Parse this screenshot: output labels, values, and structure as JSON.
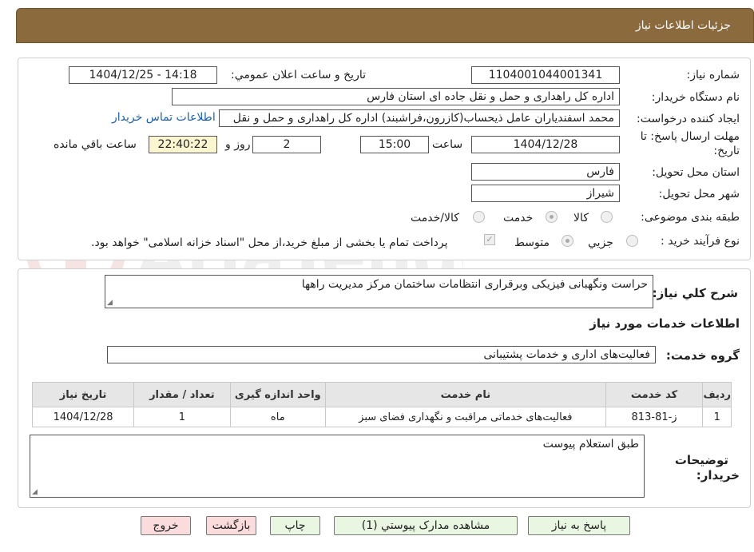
{
  "header": {
    "title": "جزئيات اطلاعات نياز"
  },
  "watermark": {
    "text": "AriaTender.neT"
  },
  "form": {
    "need_number_label": "شماره نياز:",
    "need_number": "1104001044001341",
    "announce_label": "تاريخ و ساعت اعلان عمومي:",
    "announce_value": "1404/12/25 - 14:18",
    "buyer_org_label": "نام دستگاه خريدار:",
    "buyer_org": "اداره کل راهداری و حمل و نقل جاده ای استان فارس",
    "creator_label": "ايجاد کننده درخواست:",
    "creator": "محمد اسفندیاران عامل ذیحساب(کازرون،فراشبند) اداره کل راهداری و حمل و نقل",
    "contact_link": "اطلاعات تماس خريدار",
    "deadline_label_1": "مهلت ارسال پاسخ: تا",
    "deadline_label_2": "تاريخ:",
    "deadline_date": "1404/12/28",
    "time_label": "ساعت",
    "deadline_time": "15:00",
    "days": "2",
    "days_label": "روز و",
    "remaining": "22:40:22",
    "remaining_label": "ساعت باقي مانده",
    "province_label": "استان محل تحويل:",
    "province": "فارس",
    "city_label": "شهر محل تحويل:",
    "city": "شيراز",
    "category_label": "طبقه بندی موضوعی:",
    "category_options": [
      "کالا",
      "خدمت",
      "کالا/خدمت"
    ],
    "category_selected": "خدمت",
    "process_label": "نوع فرآيند خريد :",
    "process_options": [
      "جزيي",
      "متوسط"
    ],
    "process_selected": "متوسط",
    "payment_note": "پرداخت تمام یا بخشی از مبلغ خرید،از محل \"اسناد خزانه اسلامی\" خواهد بود."
  },
  "description": {
    "label": "شرح کلي نياز:",
    "value": "حراست ونگهبانی فیزیکی وبرقراری انتظامات ساختمان مرکز مدیریت راهها"
  },
  "services": {
    "section_title": "اطلاعات خدمات مورد نياز",
    "group_label": "گروه خدمت:",
    "group_value": "فعالیت‌های اداری و خدمات پشتیبانی",
    "columns": [
      "رديف",
      "کد خدمت",
      "نام خدمت",
      "واحد اندازه گيری",
      "تعداد / مقدار",
      "تاريخ نياز"
    ],
    "rows": [
      [
        "1",
        "ز-81-813",
        "فعالیت‌های خدماتی مراقبت و نگهداری فضای سبز",
        "ماه",
        "1",
        "1404/12/28"
      ]
    ]
  },
  "buyer_notes": {
    "label_1": "توضيحات",
    "label_2": "خريدار:",
    "value": "طبق استعلام پیوست"
  },
  "buttons": {
    "reply": "پاسخ به نياز",
    "attachments": "مشاهده مدارک پيوستي (1)",
    "print": "چاپ",
    "back": "بازگشت",
    "exit": "خروج"
  }
}
